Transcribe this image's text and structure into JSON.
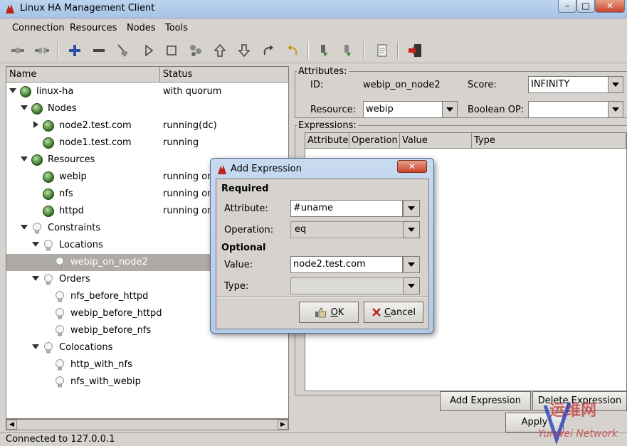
{
  "window": {
    "title": "Linux HA Management Client"
  },
  "menu": [
    "Connection",
    "Resources",
    "Nodes",
    "Tools"
  ],
  "tree": {
    "headers": {
      "name": "Name",
      "status": "Status"
    },
    "rows": [
      {
        "label": "linux-ha",
        "status": "with quorum",
        "level": 0,
        "icon": "green-dot",
        "arrow": "down"
      },
      {
        "label": "Nodes",
        "status": "",
        "level": 1,
        "icon": "green-dot",
        "arrow": "down"
      },
      {
        "label": "node2.test.com",
        "status": "running(dc)",
        "level": 2,
        "icon": "green-dot",
        "arrow": "right"
      },
      {
        "label": "node1.test.com",
        "status": "running",
        "level": 2,
        "icon": "green-dot",
        "arrow": "none"
      },
      {
        "label": "Resources",
        "status": "",
        "level": 1,
        "icon": "green-dot",
        "arrow": "down"
      },
      {
        "label": "webip",
        "status": "running on",
        "level": 2,
        "icon": "green-dot",
        "arrow": "none"
      },
      {
        "label": "nfs",
        "status": "running on",
        "level": 2,
        "icon": "green-dot",
        "arrow": "none"
      },
      {
        "label": "httpd",
        "status": "running on",
        "level": 2,
        "icon": "green-dot",
        "arrow": "none"
      },
      {
        "label": "Constraints",
        "status": "",
        "level": 1,
        "icon": "bulb",
        "arrow": "down"
      },
      {
        "label": "Locations",
        "status": "",
        "level": 2,
        "icon": "bulb",
        "arrow": "down"
      },
      {
        "label": "webip_on_node2",
        "status": "",
        "level": 3,
        "icon": "bulb",
        "arrow": "none",
        "selected": true
      },
      {
        "label": "Orders",
        "status": "",
        "level": 2,
        "icon": "bulb",
        "arrow": "down"
      },
      {
        "label": "nfs_before_httpd",
        "status": "",
        "level": 3,
        "icon": "bulb",
        "arrow": "none"
      },
      {
        "label": "webip_before_httpd",
        "status": "",
        "level": 3,
        "icon": "bulb",
        "arrow": "none"
      },
      {
        "label": "webip_before_nfs",
        "status": "",
        "level": 3,
        "icon": "bulb",
        "arrow": "none"
      },
      {
        "label": "Colocations",
        "status": "",
        "level": 2,
        "icon": "bulb",
        "arrow": "down"
      },
      {
        "label": "http_with_nfs",
        "status": "",
        "level": 3,
        "icon": "bulb",
        "arrow": "none"
      },
      {
        "label": "nfs_with_webip",
        "status": "",
        "level": 3,
        "icon": "bulb",
        "arrow": "none"
      }
    ]
  },
  "attributes": {
    "group_label": "Attributes:",
    "id_label": "ID:",
    "id_value": "webip_on_node2",
    "score_label": "Score:",
    "score_value": "INFINITY",
    "resource_label": "Resource:",
    "resource_value": "webip",
    "boolean_label": "Boolean OP:",
    "boolean_value": ""
  },
  "expressions": {
    "group_label": "Expressions:",
    "columns": [
      "Attribute",
      "Operation",
      "Value",
      "Type"
    ],
    "add_button": "Add Expression",
    "delete_button": "Delete Expression",
    "apply_button": "Apply"
  },
  "status_bar": "Connected to 127.0.0.1",
  "dialog": {
    "title": "Add Expression",
    "required_label": "Required",
    "attribute_label": "Attribute:",
    "attribute_value": "#uname",
    "operation_label": "Operation:",
    "operation_value": "eq",
    "optional_label": "Optional",
    "value_label": "Value:",
    "value_value": "node2.test.com",
    "type_label": "Type:",
    "type_value": "",
    "ok_button": "OK",
    "cancel_button": "Cancel"
  },
  "watermark": {
    "text": "Yunwei Network"
  }
}
